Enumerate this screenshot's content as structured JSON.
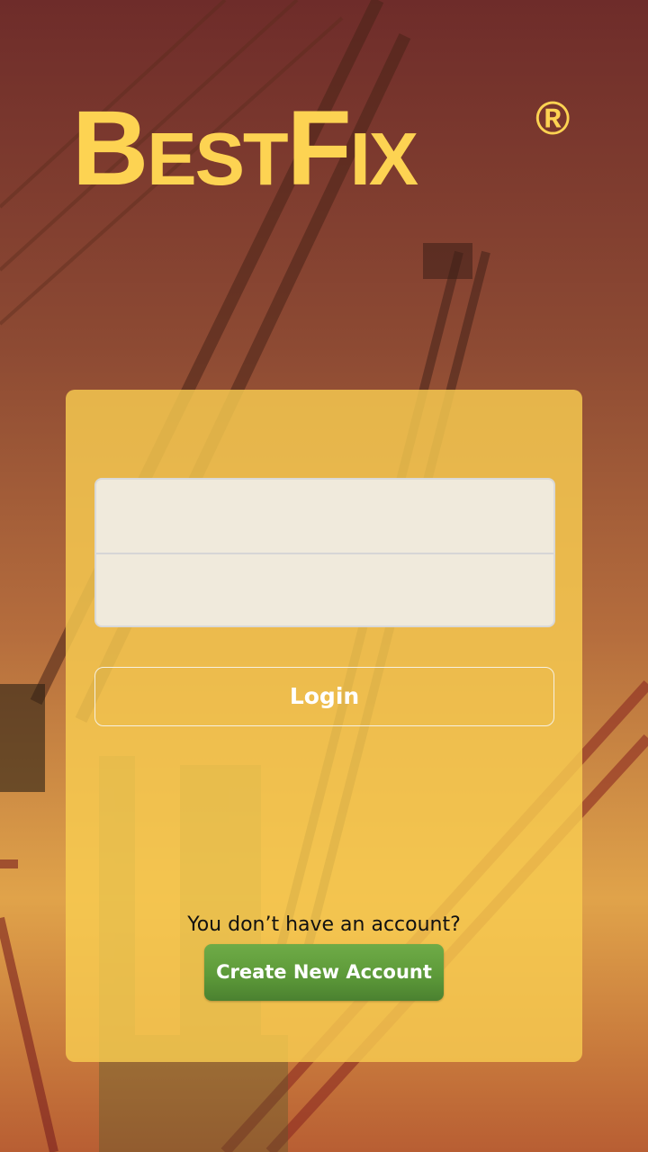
{
  "app": {
    "logo_text": "BestFix",
    "logo_mark": "®"
  },
  "login_form": {
    "username_value": "",
    "username_placeholder": "",
    "password_value": "",
    "password_placeholder": "",
    "login_label": "Login"
  },
  "signup": {
    "prompt": "You don’t have an account?",
    "create_label": "Create New Account"
  },
  "theme": {
    "logo_color": "#fdd352",
    "card_color": "#f8cc50",
    "create_button_color": "#5d9a39"
  },
  "icons": {
    "background": "construction-cranes-photo"
  }
}
